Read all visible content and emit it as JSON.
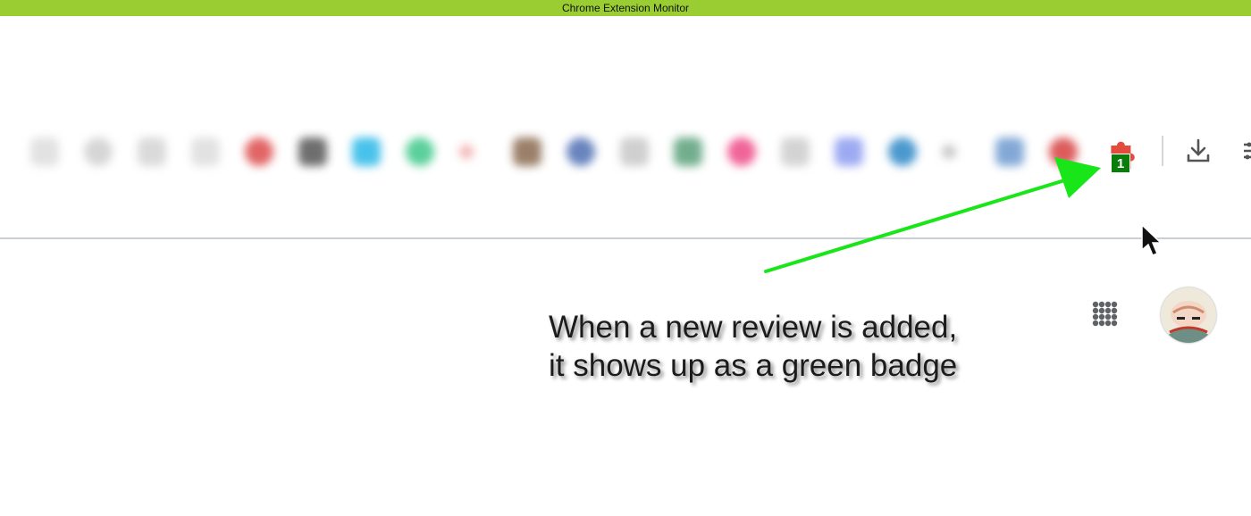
{
  "window": {
    "title": "Chrome Extension Monitor",
    "title_bar_color": "#9acd32"
  },
  "toolbar": {
    "blurred_extension_colors": [
      "#dddddd",
      "#cfcfcf",
      "#d4d4d4",
      "#dddddd",
      "#dd4b4b",
      "#555555",
      "#29b8e8",
      "#3ec88a",
      "#f2a9a9",
      "#8a6a50",
      "#4f6fb3",
      "#c7c7c7",
      "#5aa07a",
      "#ee4a86",
      "#cccccc",
      "#8d9cf0",
      "#2c87c7",
      "#bdbdbd",
      "#6e9ad0",
      "#d64040"
    ],
    "puzzle_icon": "puzzle-icon",
    "puzzle_color": "#e44b3f",
    "badge": {
      "count": "1",
      "color": "#0b7d0b"
    },
    "download_icon": "download-icon",
    "menu_icon": "menu-icon"
  },
  "annotation": {
    "arrow_color": "#19e619",
    "caption_line1": "When a new review is added,",
    "caption_line2": "it shows up as a green badge"
  },
  "page": {
    "apps_icon": "apps-grid-icon",
    "avatar": "user-avatar"
  }
}
